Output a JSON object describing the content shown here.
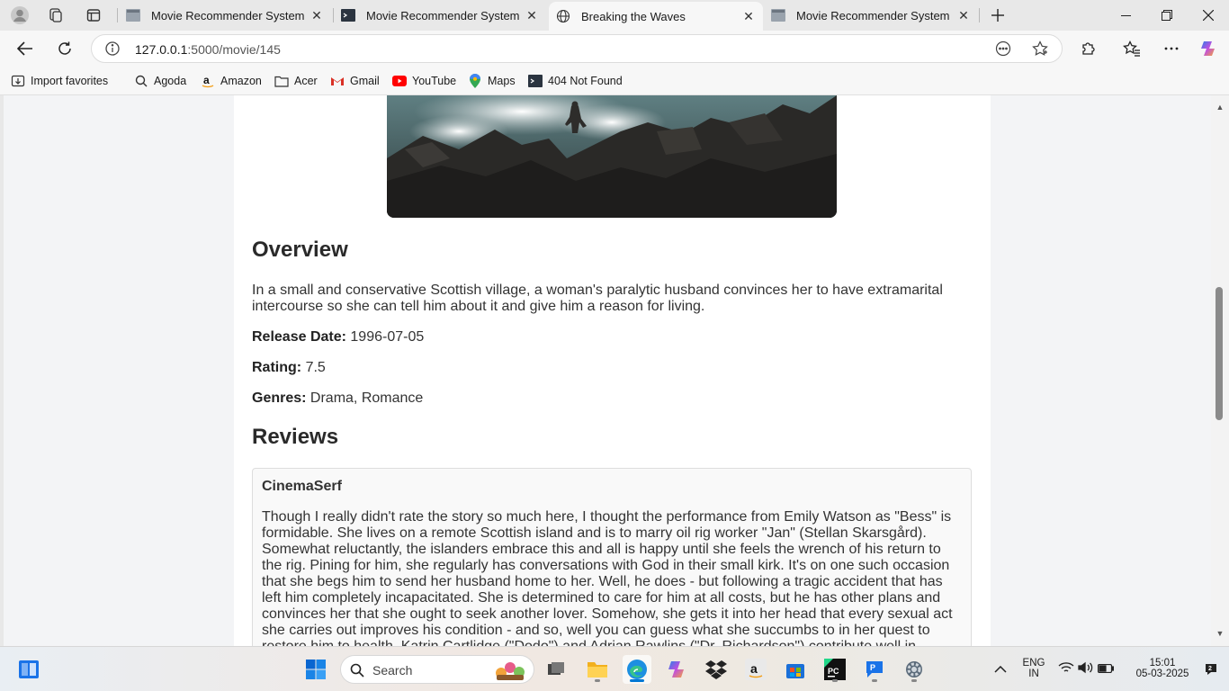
{
  "browser": {
    "tabs": [
      {
        "title": "Movie Recommender System",
        "active": false
      },
      {
        "title": "Movie Recommender System",
        "active": false
      },
      {
        "title": "Breaking the Waves",
        "active": true
      },
      {
        "title": "Movie Recommender System",
        "active": false
      }
    ],
    "address": {
      "host": "127.0.0.1",
      "path": ":5000/movie/145"
    },
    "favorites": [
      {
        "label": "Import favorites",
        "icon": "import-icon"
      },
      {
        "label": "Agoda",
        "icon": "search-icon"
      },
      {
        "label": "Amazon",
        "icon": "amazon-icon"
      },
      {
        "label": "Acer",
        "icon": "folder-icon"
      },
      {
        "label": "Gmail",
        "icon": "gmail-icon"
      },
      {
        "label": "YouTube",
        "icon": "youtube-icon"
      },
      {
        "label": "Maps",
        "icon": "maps-icon"
      },
      {
        "label": "404 Not Found",
        "icon": "terminal-icon"
      }
    ]
  },
  "page": {
    "overview_heading": "Overview",
    "overview_text": "In a small and conservative Scottish village, a woman's paralytic husband convinces her to have extramarital intercourse so she can tell him about it and give him a reason for living.",
    "release_label": "Release Date:",
    "release_value": "1996-07-05",
    "rating_label": "Rating:",
    "rating_value": "7.5",
    "genres_label": "Genres:",
    "genres_value": "Drama, Romance",
    "reviews_heading": "Reviews",
    "review": {
      "author": "CinemaSerf",
      "content": "Though I really didn't rate the story so much here, I thought the performance from Emily Watson as \"Bess\" is formidable. She lives on a remote Scottish island and is to marry oil rig worker \"Jan\" (Stellan Skarsgård). Somewhat reluctantly, the islanders embrace this and all is happy until she feels the wrench of his return to the rig. Pining for him, she regularly has conversations with God in their small kirk. It's on one such occasion that she begs him to send her husband home to her. Well, he does - but following a tragic accident that has left him completely incapacitated. She is determined to care for him at all costs, but he has other plans and convinces her that she ought to seek another lover. Somehow, she gets it into her head that every sexual act she carries out improves his condition - and so, well you can guess what she succumbs to in her quest to restore him to health. Katrin Cartlidge (\"Dodo\") and Adrian Rawlins (\"Dr. Richardson\") contribute well in"
    }
  },
  "taskbar": {
    "search_label": "Search",
    "lang_top": "ENG",
    "lang_bottom": "IN",
    "time": "15:01",
    "date": "05-03-2025"
  }
}
